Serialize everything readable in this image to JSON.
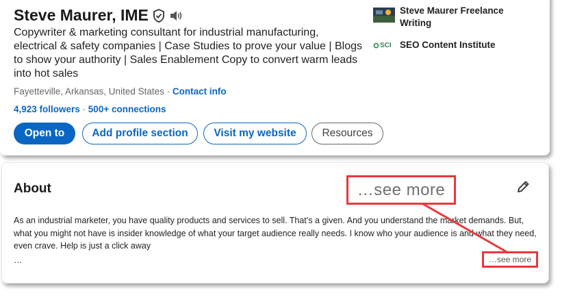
{
  "profile": {
    "name": "Steve Maurer, IME",
    "headline": "Copywriter & marketing consultant for industrial manufacturing, electrical & safety companies | Case Studies to prove your value | Blogs to show your authority | Sales Enablement Copy to convert warm leads into hot sales",
    "location": "Fayetteville, Arkansas, United States",
    "location_sep": " · ",
    "contact_info": "Contact info",
    "followers": "4,923 followers",
    "connections": "500+ connections",
    "followers_sep": " · "
  },
  "actions": {
    "open_to": "Open to",
    "add_profile_section": "Add profile section",
    "visit_website": "Visit my website",
    "resources": "Resources"
  },
  "experience": [
    {
      "name": "Steve Maurer Freelance Writing",
      "logo": "sm-logo"
    },
    {
      "name": "SEO Content Institute",
      "logo": "sci-logo",
      "logo_text": "SCI"
    }
  ],
  "about": {
    "title": "About",
    "body": "As an industrial marketer, you have quality products and services to sell. That’s a given. And you understand the market demands. But, what you might not have is insider knowledge of what your target audience really needs. I know who your audience is and what they need, even crave. Help is just a click away",
    "ellipsis": "…",
    "see_more_callout": "…see more",
    "see_more": "…see more"
  },
  "colors": {
    "accent": "#0a66c2",
    "callout": "#e8383b"
  }
}
